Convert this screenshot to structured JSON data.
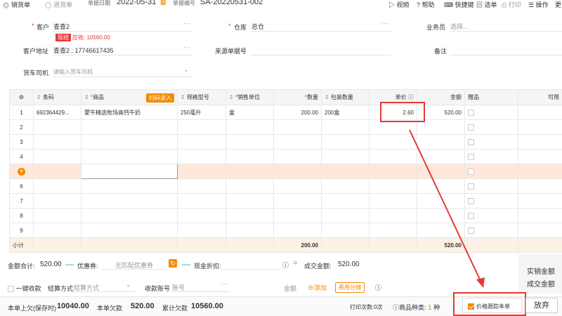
{
  "topbar": {
    "tab_sales": "销货单",
    "tab_return": "退货单",
    "date_label": "单据日期",
    "date_value": "2022-05-31",
    "number_label": "单据编号",
    "number_value": "SA-20220531-002",
    "video": "视频",
    "help": "帮助",
    "shortcut": "快捷键",
    "select_bill": "选单",
    "print": "打印",
    "operate": "操作",
    "more": "更"
  },
  "form": {
    "customer_label": "客户",
    "customer_value": "查查2",
    "cash_tag": "现结",
    "owed_text": "应收: 10560.00",
    "warehouse_label": "仓库",
    "warehouse_value": "总仓",
    "salesman_label": "业务员",
    "salesman_placeholder": "选择...",
    "address_label": "客户地址",
    "address_value": "查查2 ; 17746617435",
    "source_label": "来源单据号",
    "remark_label": "备注",
    "driver_label": "货车司机",
    "driver_placeholder": "请输入货车司机"
  },
  "grid": {
    "headers": [
      "条码",
      "商品",
      "扫码录入",
      "规格型号",
      "销售单位",
      "数量",
      "包装数量",
      "单价",
      "金额",
      "赠品",
      "可用"
    ],
    "rows": [
      {
        "idx": "1",
        "barcode": "692364429...",
        "product": "蒙牛精选牧场高钙牛奶",
        "spec": "250毫升",
        "unit": "盒",
        "qty": "200.00",
        "pack": "200盒",
        "price": "2.60",
        "amount": "520.00"
      },
      {
        "idx": "2"
      },
      {
        "idx": "3"
      },
      {
        "idx": "4"
      },
      {
        "idx": "+"
      },
      {
        "idx": "6"
      },
      {
        "idx": "7"
      },
      {
        "idx": "8"
      },
      {
        "idx": "9"
      }
    ],
    "subtotal_label": "小计",
    "subtotal_qty": "200.00",
    "subtotal_amount": "520.00"
  },
  "totals": {
    "total_label": "金额合计:",
    "total_value": "520.00",
    "coupon_label": "优惠券:",
    "coupon_value": "无匹配优惠券",
    "cash_discount_label": "现金折扣:",
    "deal_label": "成交金额:",
    "deal_value": "520.00",
    "actual_label": "实销金额",
    "deal_label_right": "成交金额"
  },
  "payment": {
    "oneclick_label": "一键收款",
    "method_label": "结算方式",
    "method_placeholder": "结算方式",
    "account_label": "收款账号",
    "account_placeholder": "账号",
    "amount_label": "金额",
    "add_label": "添加",
    "split_label": "费用分摊"
  },
  "footer": {
    "prev_owed_label": "本单上欠(保存时)",
    "prev_owed_value": "10040.00",
    "this_owed_label": "本单欠款",
    "this_owed_value": "520.00",
    "total_owed_label": "累计欠款",
    "total_owed_value": "10560.00",
    "print_count": "打印次数:0次",
    "kinds_label": "商品种类:",
    "kinds_value": "1",
    "kinds_unit": "种",
    "track_label": "价格跟踪本单",
    "abandon": "放弃"
  },
  "colors": {
    "accent": "#f08c00",
    "highlight": "#e53935"
  }
}
